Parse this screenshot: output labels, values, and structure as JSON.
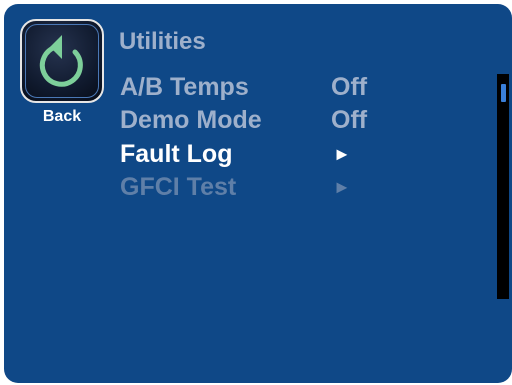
{
  "back": {
    "label": "Back",
    "icon": "back-arrow-icon"
  },
  "screen": {
    "title": "Utilities"
  },
  "menu": {
    "items": [
      {
        "label": "A/B Temps",
        "value": "Off",
        "state": "normal"
      },
      {
        "label": "Demo Mode",
        "value": "Off",
        "state": "normal"
      },
      {
        "label": "Fault Log",
        "arrow": "►",
        "state": "selected"
      },
      {
        "label": "GFCI Test",
        "arrow": "►",
        "state": "disabled"
      }
    ]
  },
  "colors": {
    "panel_background": "#0f4887",
    "text_normal": "#9eb0cb",
    "text_selected": "#ffffff",
    "text_disabled": "#5f7fa8",
    "icon_accent": "#7dcf9a",
    "scroll_thumb": "#3a7fd8"
  }
}
